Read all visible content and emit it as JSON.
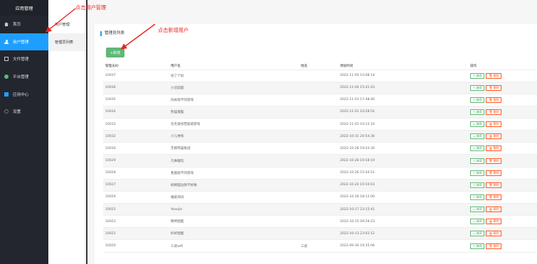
{
  "sidebar": {
    "header": "应用管理",
    "items": [
      {
        "label": "首页",
        "icon": "home-icon"
      },
      {
        "label": "用户管理",
        "icon": "user-icon"
      },
      {
        "label": "文件管理",
        "icon": "file-icon"
      },
      {
        "label": "平台管理",
        "icon": "platform-icon"
      },
      {
        "label": "应用中心",
        "icon": "app-grid-icon"
      },
      {
        "label": "设置",
        "icon": "gear-icon"
      }
    ]
  },
  "submenu": {
    "items": [
      "用户管理",
      "管理员列表"
    ]
  },
  "main": {
    "card_title": "管理员列表",
    "add_button": "+新增",
    "columns": [
      "管理员ID",
      "用户名",
      "姓名",
      "添加时间",
      "操作"
    ],
    "edit_label": "编辑",
    "delete_label": "删除",
    "rows": [
      {
        "id": "10037",
        "username": "哒了个哒",
        "name": "",
        "time": "2022-11-05 15:08:14"
      },
      {
        "id": "10036",
        "username": "小灵园座",
        "name": "",
        "time": "2022-11-04 15:41:43"
      },
      {
        "id": "10035",
        "username": "闯关就不同游戏",
        "name": "",
        "time": "2022-11-01 17:48:46"
      },
      {
        "id": "10034",
        "username": "熊猫慢脑",
        "name": "",
        "time": "2022-11-01 10:28:52"
      },
      {
        "id": "10033",
        "username": "毛毛爱找茬超级游戏",
        "name": "",
        "time": "2022-11-01 10:12:10"
      },
      {
        "id": "10032",
        "username": "少儿拼购",
        "name": "",
        "time": "2022-10-31 20:54:36"
      },
      {
        "id": "10030",
        "username": "无敌熊猫挑战",
        "name": "",
        "time": "2022-10-28 19:43:30"
      },
      {
        "id": "10029",
        "username": "凡事趣玩",
        "name": "",
        "time": "2022-10-28 19:18:19"
      },
      {
        "id": "10028",
        "username": "看图就不同游戏",
        "name": "",
        "time": "2022-10-26 15:44:51"
      },
      {
        "id": "10027",
        "username": "刷刷脑边款不好做",
        "name": "",
        "time": "2022-10-24 10:10:03"
      },
      {
        "id": "10026",
        "username": "推敲测试",
        "name": "",
        "time": "2022-10-18 18:12:00"
      },
      {
        "id": "10025",
        "username": "Yeanjie",
        "name": "",
        "time": "2022-10-17 23:15:41"
      },
      {
        "id": "10023",
        "username": "精神图图",
        "name": "",
        "time": "2022-10-15 09:29:23"
      },
      {
        "id": "10022",
        "username": "好好图图",
        "name": "",
        "time": "2022-10-13 23:02:12"
      },
      {
        "id": "10020",
        "username": "三皮wifi",
        "name": "三皮",
        "time": "2022-09-30 19:35:06"
      }
    ]
  },
  "annotations": {
    "user_mgmt_note": "点击用户管理",
    "add_user_note": "点击新增用户",
    "color": "#e8251f"
  },
  "colors": {
    "sidebar_bg": "#23262e",
    "active_blue": "#1e9fff",
    "green": "#5fb878",
    "red": "#ff5722"
  }
}
